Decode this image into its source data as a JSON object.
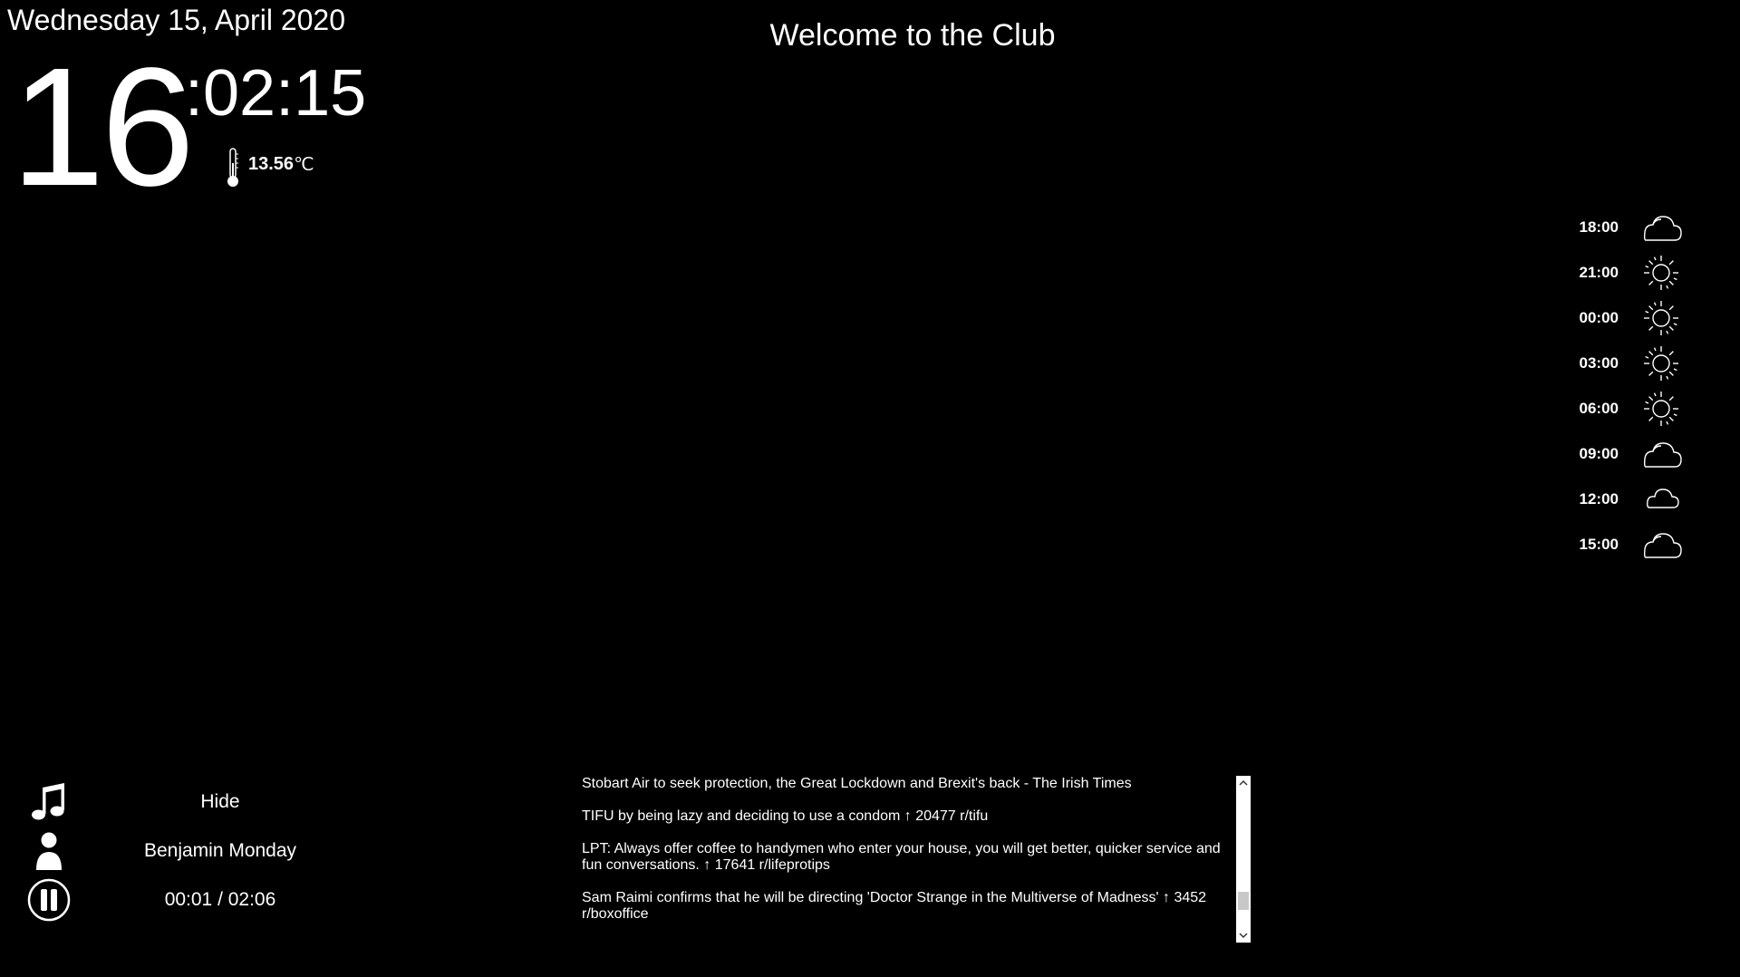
{
  "header": {
    "date": "Wednesday 15, April 2020",
    "title": "Welcome to the Club"
  },
  "clock": {
    "hour": "16",
    "minutes_seconds": ":02:15"
  },
  "temperature": {
    "value": "13.56",
    "unit": "℃",
    "icon": "thermometer-icon"
  },
  "forecast": [
    {
      "time": "18:00",
      "icon": "cloud-sun-icon"
    },
    {
      "time": "21:00",
      "icon": "sun-icon"
    },
    {
      "time": "00:00",
      "icon": "sun-icon"
    },
    {
      "time": "03:00",
      "icon": "sun-icon"
    },
    {
      "time": "06:00",
      "icon": "sun-icon"
    },
    {
      "time": "09:00",
      "icon": "cloud-sun-icon"
    },
    {
      "time": "12:00",
      "icon": "cloud-icon"
    },
    {
      "time": "15:00",
      "icon": "cloud-sun-icon"
    }
  ],
  "player": {
    "hide_label": "Hide",
    "artist": "Benjamin Monday",
    "time": "00:01 / 02:06"
  },
  "news": [
    {
      "text": "Stobart Air to seek protection, the Great Lockdown and Brexit's back - The Irish Times"
    },
    {
      "text": "TIFU by being lazy and deciding to use a condom ↑ 20477  r/tifu"
    },
    {
      "text": "LPT: Always offer coffee to handymen who enter your house, you will get better, quicker service and fun conversations. ↑ 17641  r/lifeprotips"
    },
    {
      "text": "Sam Raimi confirms that he will be directing 'Doctor Strange in the Multiverse of Madness' ↑ 3452  r/boxoffice"
    }
  ],
  "colors": {
    "background": "#000000",
    "text": "#ffffff",
    "scrollbar": "#ffffff"
  }
}
